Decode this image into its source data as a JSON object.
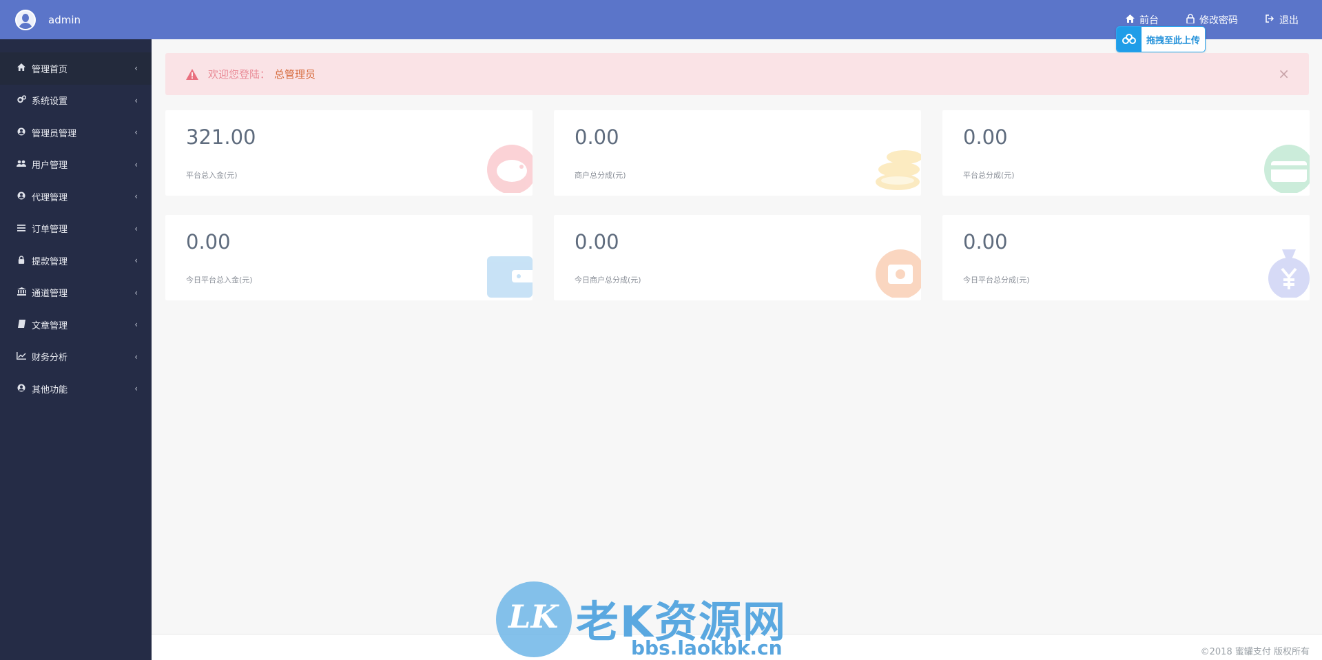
{
  "header": {
    "username": "admin",
    "links": [
      {
        "icon": "home-icon",
        "label": "前台"
      },
      {
        "icon": "lock-icon",
        "label": "修改密码"
      },
      {
        "icon": "logout-icon",
        "label": "退出"
      }
    ],
    "upload_label": "拖拽至此上传"
  },
  "sidebar": {
    "items": [
      {
        "icon": "home-icon",
        "label": "管理首页"
      },
      {
        "icon": "gears-icon",
        "label": "系统设置"
      },
      {
        "icon": "user-circle-icon",
        "label": "管理员管理"
      },
      {
        "icon": "users-icon",
        "label": "用户管理"
      },
      {
        "icon": "user-circle-icon",
        "label": "代理管理"
      },
      {
        "icon": "list-icon",
        "label": "订单管理"
      },
      {
        "icon": "lock-icon",
        "label": "提款管理"
      },
      {
        "icon": "bank-icon",
        "label": "通道管理"
      },
      {
        "icon": "book-icon",
        "label": "文章管理"
      },
      {
        "icon": "line-chart-icon",
        "label": "财务分析"
      },
      {
        "icon": "user-circle-icon",
        "label": "其他功能"
      }
    ]
  },
  "alert": {
    "message": "欢迎您登陆：",
    "role": "总管理员",
    "close": "×"
  },
  "cards": [
    {
      "value": "321.00",
      "caption": "平台总入金(元)",
      "icon": "piggy-bank-icon",
      "color": "#f7a1a8"
    },
    {
      "value": "0.00",
      "caption": "商户总分成(元)",
      "icon": "coins-icon",
      "color": "#f9d98a"
    },
    {
      "value": "0.00",
      "caption": "平台总分成(元)",
      "icon": "credit-card-icon",
      "color": "#9ed9b6"
    },
    {
      "value": "0.00",
      "caption": "今日平台总入金(元)",
      "icon": "wallet-icon",
      "color": "#9cc9ee"
    },
    {
      "value": "0.00",
      "caption": "今日商户总分成(元)",
      "icon": "money-circle-icon",
      "color": "#f5b088"
    },
    {
      "value": "0.00",
      "caption": "今日平台总分成(元)",
      "icon": "money-bag-icon",
      "color": "#b8bff0"
    }
  ],
  "footer": {
    "copyright": "©2018 蜜罐支付 版权所有"
  },
  "watermark": {
    "logo": "LK",
    "name": "老K资源网",
    "url": "bbs.laokbk.cn"
  }
}
